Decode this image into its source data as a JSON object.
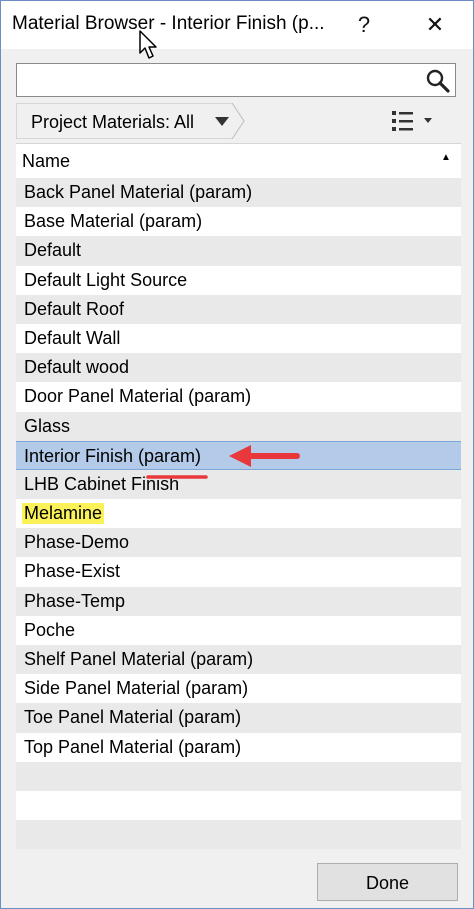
{
  "window": {
    "title": "Material Browser - Interior Finish (p...",
    "help_label": "?",
    "close_label": "✕"
  },
  "search": {
    "value": "",
    "placeholder": ""
  },
  "filter": {
    "label": "Project Materials: All"
  },
  "list": {
    "column_header": "Name",
    "sort_indicator": "▲",
    "rows": [
      {
        "label": "Back Panel Material (param)"
      },
      {
        "label": "Base Material (param)"
      },
      {
        "label": "Default"
      },
      {
        "label": "Default Light Source"
      },
      {
        "label": "Default Roof"
      },
      {
        "label": "Default Wall"
      },
      {
        "label": "Default wood"
      },
      {
        "label": "Door Panel Material (param)"
      },
      {
        "label": "Glass"
      },
      {
        "label": "Interior Finish (param)"
      },
      {
        "label": "LHB Cabinet Finish"
      },
      {
        "label": "Melamine"
      },
      {
        "label": "Phase-Demo"
      },
      {
        "label": "Phase-Exist"
      },
      {
        "label": "Phase-Temp"
      },
      {
        "label": "Poche"
      },
      {
        "label": "Shelf Panel Material (param)"
      },
      {
        "label": "Side Panel Material (param)"
      },
      {
        "label": "Toe Panel Material (param)"
      },
      {
        "label": "Top Panel Material (param)"
      },
      {
        "label": ""
      },
      {
        "label": ""
      },
      {
        "label": ""
      }
    ],
    "selected_row": "Interior Finish (param)",
    "highlighted_row": "Melamine"
  },
  "footer": {
    "done_label": "Done"
  },
  "colors": {
    "selection": "#b3cbe8",
    "highlight": "#fbf25a",
    "annotation": "#e8383b"
  }
}
